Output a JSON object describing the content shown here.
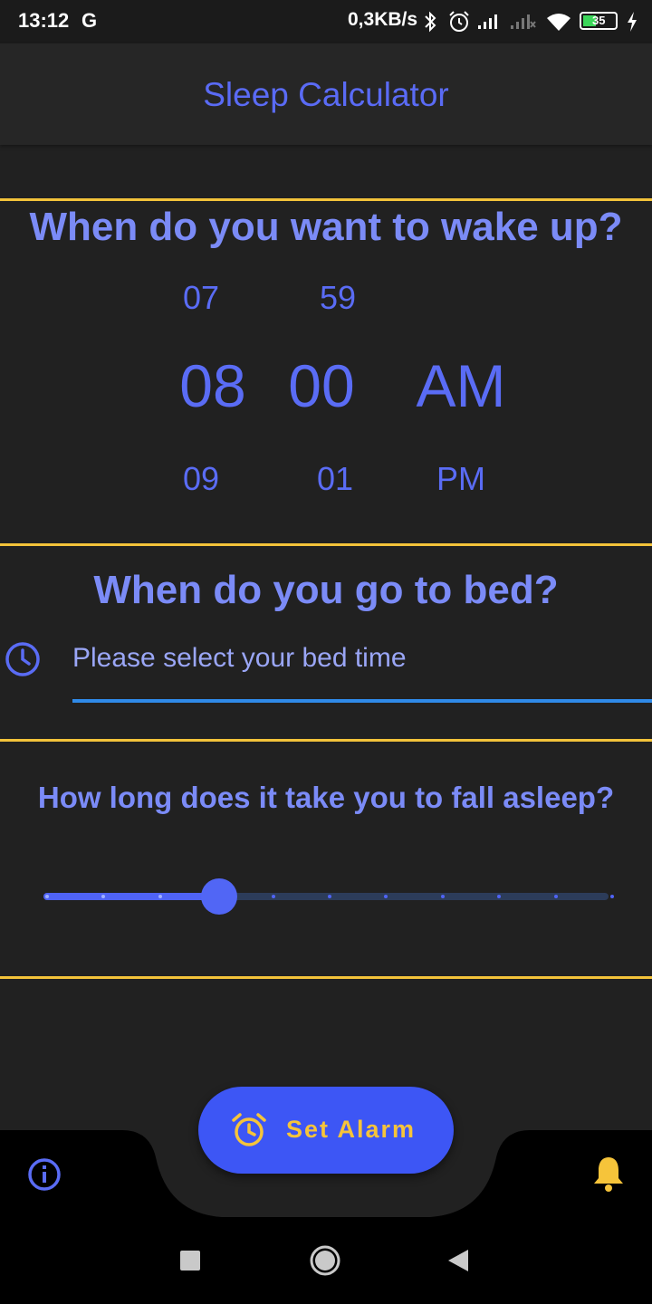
{
  "status": {
    "time": "13:12",
    "carrier_icon": "G",
    "speed": "0,3KB/s",
    "battery": "35"
  },
  "app": {
    "title": "Sleep Calculator"
  },
  "wake": {
    "heading": "When do you want to wake up?",
    "hour_prev": "07",
    "minute_prev": "59",
    "hour": "08",
    "minute": "00",
    "period": "AM",
    "hour_next": "09",
    "minute_next": "01",
    "period_next": "PM"
  },
  "bed": {
    "heading": "When do you go to bed?",
    "placeholder": "Please select your bed time"
  },
  "asleep": {
    "heading": "How long does it take you to fall asleep?",
    "slider_value_fraction": 0.3,
    "slider_divisions": 10
  },
  "fab": {
    "label": "Set Alarm"
  },
  "colors": {
    "accent": "#5a6cf5",
    "fab": "#3d56f5",
    "divider": "#f3c33a",
    "underline": "#2f8ae8",
    "bell": "#f6c43a"
  },
  "icons": {
    "bed_field": "clock-icon",
    "fab": "alarm-clock-icon",
    "bottom_left": "info-icon",
    "bottom_right": "bell-icon",
    "nav": [
      "recents-square-icon",
      "home-circle-icon",
      "back-triangle-icon"
    ]
  }
}
